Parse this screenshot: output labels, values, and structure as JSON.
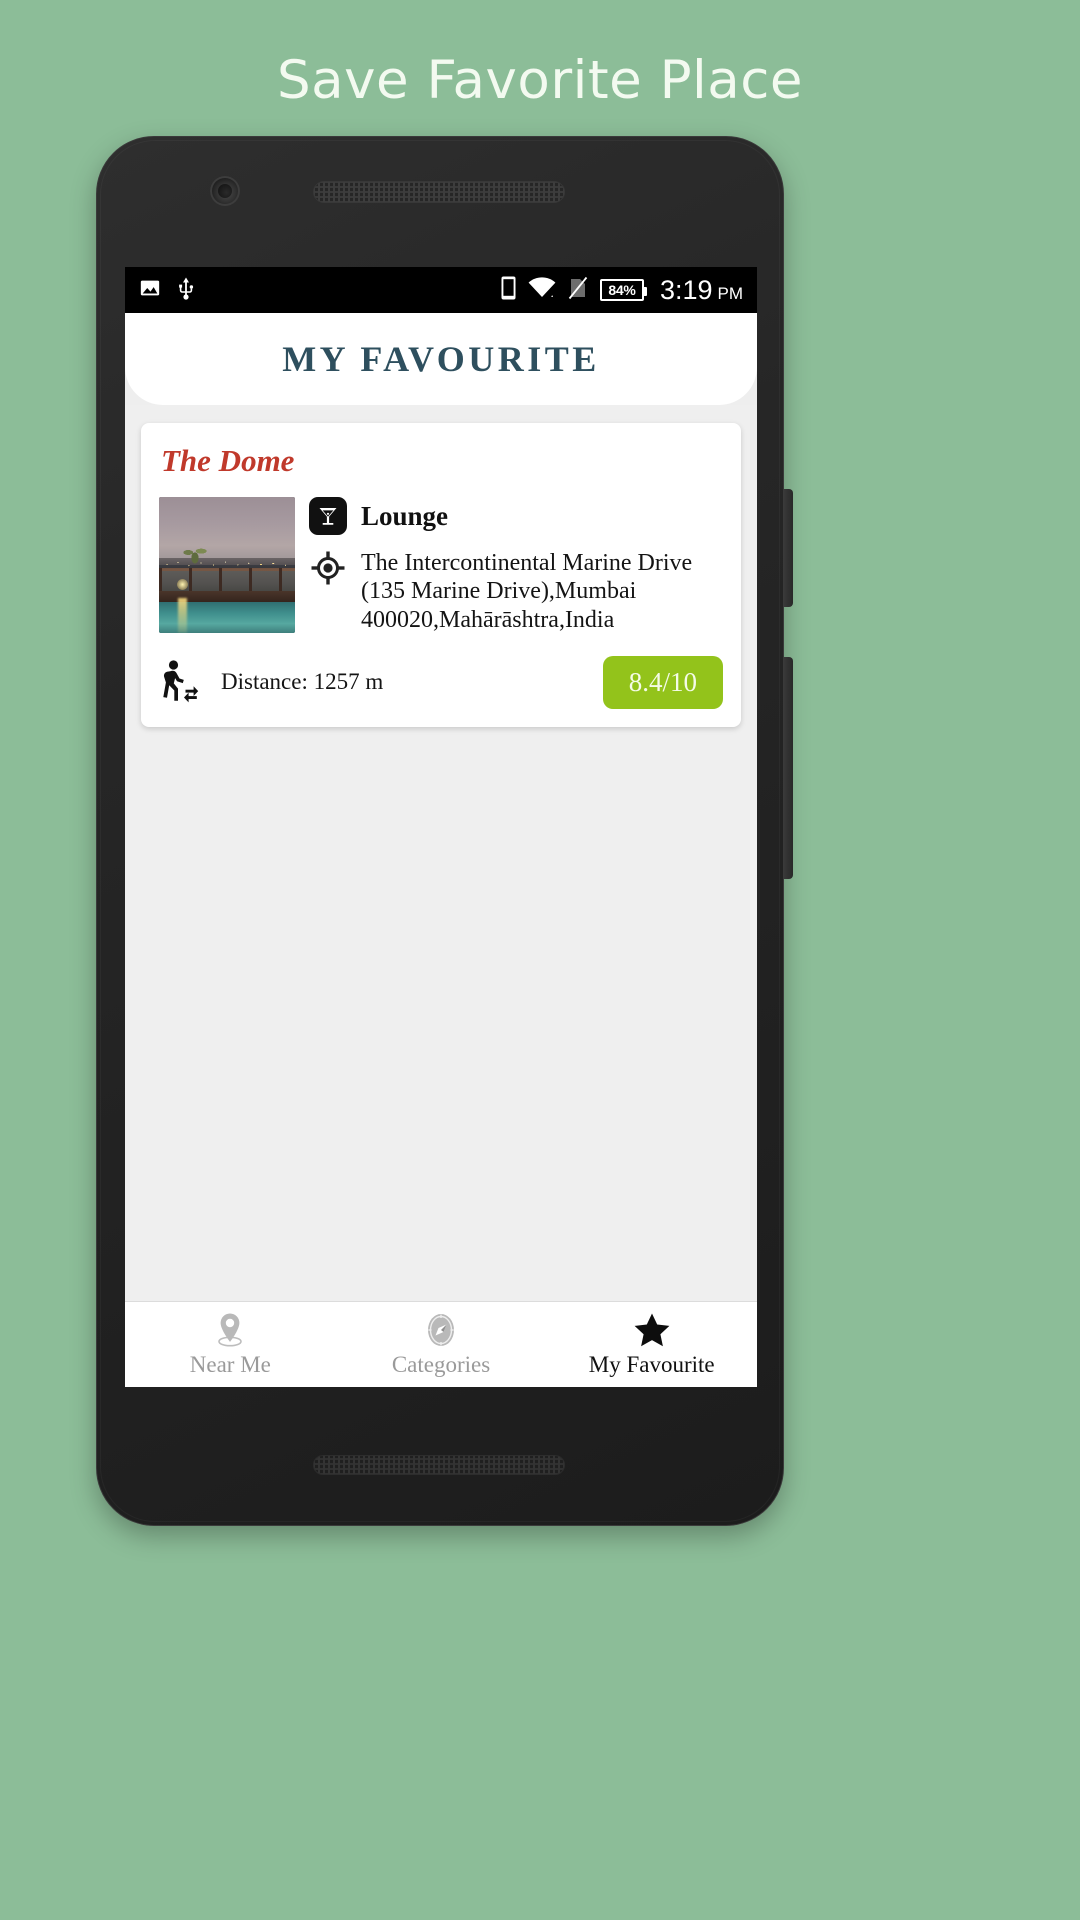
{
  "promo": {
    "title": "Save Favorite Place"
  },
  "theme": {
    "background_green": "#8cbd98",
    "promo_text": "#f3faf0",
    "header_title": "#2e4f5e",
    "place_name_red": "#c0392b",
    "rating_green": "#93c31b",
    "nav_inactive": "#9a9a9a",
    "nav_active": "#111111"
  },
  "status_bar": {
    "left_icons": [
      "image-icon",
      "usb-icon"
    ],
    "right_icons": [
      "phone-icon",
      "wifi-icon",
      "sim-off-icon"
    ],
    "battery": "84%",
    "time": "3:19",
    "meridiem": "PM"
  },
  "header": {
    "title": "MY FAVOURITE"
  },
  "card": {
    "place_name": "The Dome",
    "thumbnail_alt": "rooftop-pool-night-skyline",
    "category_icon": "cocktail-glass-icon",
    "category": "Lounge",
    "location_icon": "crosshair-target-icon",
    "address": "The Intercontinental Marine Drive (135 Marine Drive),Mumbai 400020,Mahārāshtra,India",
    "distance_icon": "walking-person-icon",
    "distance": "Distance: 1257 m",
    "rating": "8.4/10"
  },
  "bottom_nav": {
    "items": [
      {
        "label": "Near Me",
        "icon": "map-pin-icon",
        "active": false
      },
      {
        "label": "Categories",
        "icon": "compass-icon",
        "active": false
      },
      {
        "label": "My Favourite",
        "icon": "star-icon",
        "active": true
      }
    ]
  }
}
